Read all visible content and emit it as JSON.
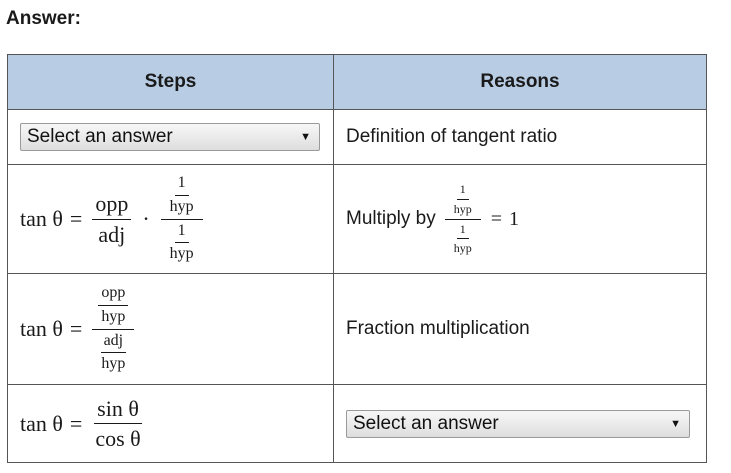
{
  "answer_label": "Answer:",
  "table": {
    "headers": {
      "steps": "Steps",
      "reasons": "Reasons"
    },
    "rows": [
      {
        "step_select": {
          "value": "Select an answer"
        },
        "reason": "Definition of tangent ratio"
      },
      {
        "step_math": {
          "lhs": "tan θ",
          "equals": "=",
          "opp": "opp",
          "adj": "adj",
          "dot": "·",
          "one": "1",
          "hyp": "hyp"
        },
        "reason_prefix": "Multiply by",
        "reason_math": {
          "one": "1",
          "hyp": "hyp",
          "equals": "=",
          "result": "1"
        }
      },
      {
        "step_math": {
          "lhs": "tan θ",
          "equals": "=",
          "opp": "opp",
          "adj": "adj",
          "hyp": "hyp"
        },
        "reason": "Fraction multiplication"
      },
      {
        "step_math": {
          "lhs": "tan θ",
          "equals": "=",
          "num": "sin θ",
          "den": "cos θ"
        },
        "reason_select": {
          "value": "Select an answer"
        }
      }
    ]
  },
  "icons": {
    "dropdown": "chevron-down-icon"
  }
}
